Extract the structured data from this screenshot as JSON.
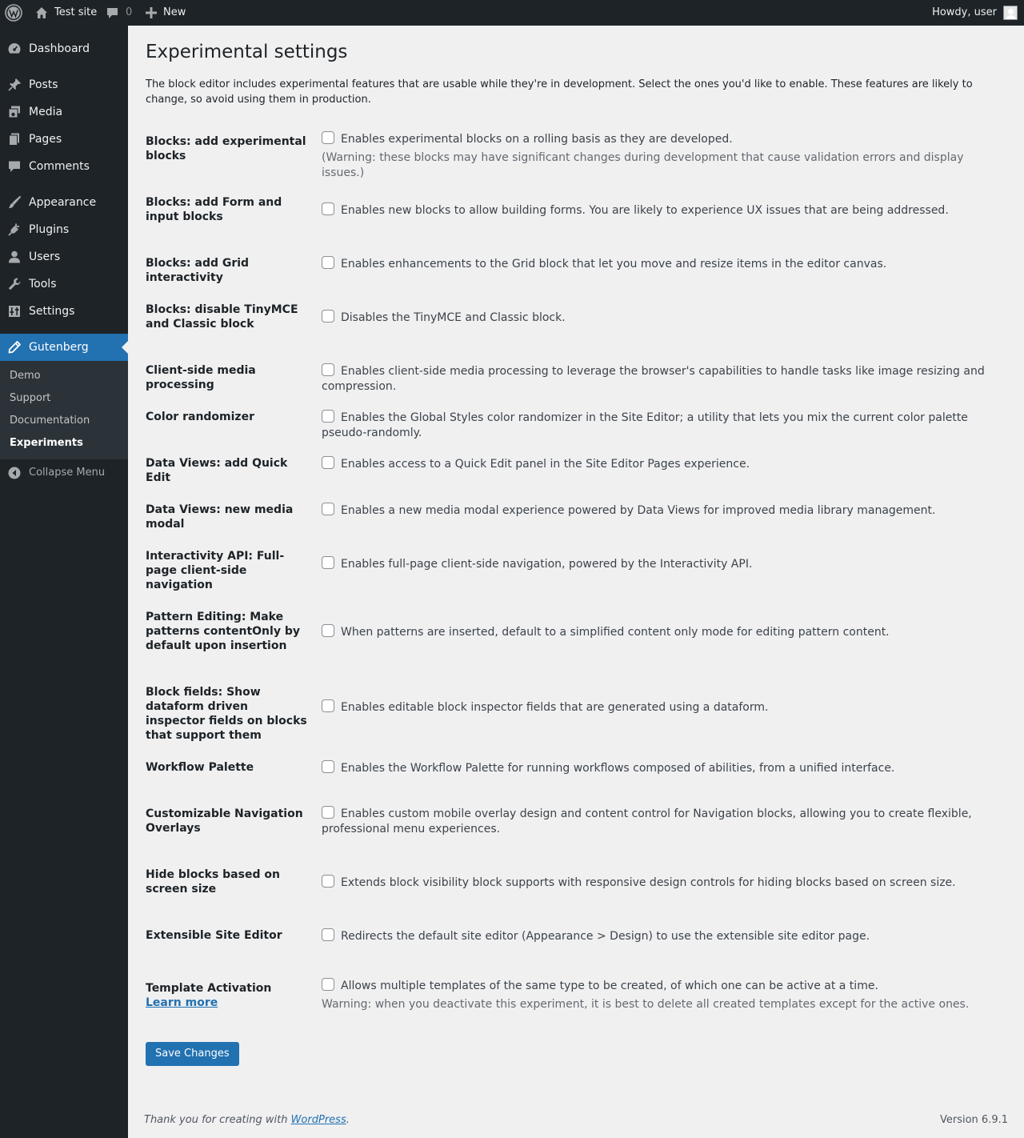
{
  "admin_bar": {
    "site_name": "Test site",
    "comment_count": "0",
    "new_label": "New",
    "greeting": "Howdy, user"
  },
  "sidebar": {
    "items": [
      {
        "label": "Dashboard",
        "icon": "dashboard-icon"
      },
      {
        "label": "Posts",
        "icon": "pin-icon"
      },
      {
        "label": "Media",
        "icon": "media-icon"
      },
      {
        "label": "Pages",
        "icon": "pages-icon"
      },
      {
        "label": "Comments",
        "icon": "comments-icon"
      },
      {
        "label": "Appearance",
        "icon": "brush-icon"
      },
      {
        "label": "Plugins",
        "icon": "plug-icon"
      },
      {
        "label": "Users",
        "icon": "user-icon"
      },
      {
        "label": "Tools",
        "icon": "wrench-icon"
      },
      {
        "label": "Settings",
        "icon": "settings-icon"
      },
      {
        "label": "Gutenberg",
        "icon": "pencil-icon"
      }
    ],
    "submenu": [
      "Demo",
      "Support",
      "Documentation",
      "Experiments"
    ],
    "collapse_label": "Collapse Menu",
    "accent_color": "#2271b1"
  },
  "main": {
    "title": "Experimental settings",
    "intro": "The block editor includes experimental features that are usable while they're in development. Select the ones you'd like to enable. These features are likely to change, so avoid using them in production.",
    "rows": [
      {
        "label": "Blocks: add experimental blocks",
        "description": "Enables experimental blocks on a rolling basis as they are developed.",
        "note": "(Warning: these blocks may have significant changes during development that cause validation errors and display issues.)"
      },
      {
        "label": "Blocks: add Form and input blocks",
        "description": "Enables new blocks to allow building forms. You are likely to experience UX issues that are being addressed."
      },
      {
        "label": "Blocks: add Grid interactivity",
        "description": "Enables enhancements to the Grid block that let you move and resize items in the editor canvas."
      },
      {
        "label": "Blocks: disable TinyMCE and Classic block",
        "description": "Disables the TinyMCE and Classic block."
      },
      {
        "label": "Client-side media processing",
        "description": "Enables client-side media processing to leverage the browser's capabilities to handle tasks like image resizing and compression."
      },
      {
        "label": "Color randomizer",
        "description": "Enables the Global Styles color randomizer in the Site Editor; a utility that lets you mix the current color palette pseudo-randomly."
      },
      {
        "label": "Data Views: add Quick Edit",
        "description": "Enables access to a Quick Edit panel in the Site Editor Pages experience."
      },
      {
        "label": "Data Views: new media modal",
        "description": "Enables a new media modal experience powered by Data Views for improved media library management."
      },
      {
        "label": "Interactivity API: Full-page client-side navigation",
        "description": "Enables full-page client-side navigation, powered by the Interactivity API."
      },
      {
        "label": "Pattern Editing: Make patterns contentOnly by default upon insertion",
        "description": "When patterns are inserted, default to a simplified content only mode for editing pattern content."
      },
      {
        "label": "Block fields: Show dataform driven inspector fields on blocks that support them",
        "description": "Enables editable block inspector fields that are generated using a dataform."
      },
      {
        "label": "Workflow Palette",
        "description": "Enables the Workflow Palette for running workflows composed of abilities, from a unified interface."
      },
      {
        "label": "Customizable Navigation Overlays",
        "description": "Enables custom mobile overlay design and content control for Navigation blocks, allowing you to create flexible, professional menu experiences."
      },
      {
        "label": "Hide blocks based on screen size",
        "description": "Extends block visibility block supports with responsive design controls for hiding blocks based on screen size."
      },
      {
        "label": "Extensible Site Editor",
        "description": "Redirects the default site editor (Appearance > Design) to use the extensible site editor page."
      },
      {
        "label": "Template Activation",
        "link": "Learn more",
        "description": "Allows multiple templates of the same type to be created, of which one can be active at a time.",
        "note": "Warning: when you deactivate this experiment, it is best to delete all created templates except for the active ones."
      }
    ],
    "save_label": "Save Changes"
  },
  "footer": {
    "thanks_prefix": "Thank you for creating with ",
    "thanks_link": "WordPress",
    "thanks_suffix": ".",
    "version": "Version 6.9.1"
  }
}
